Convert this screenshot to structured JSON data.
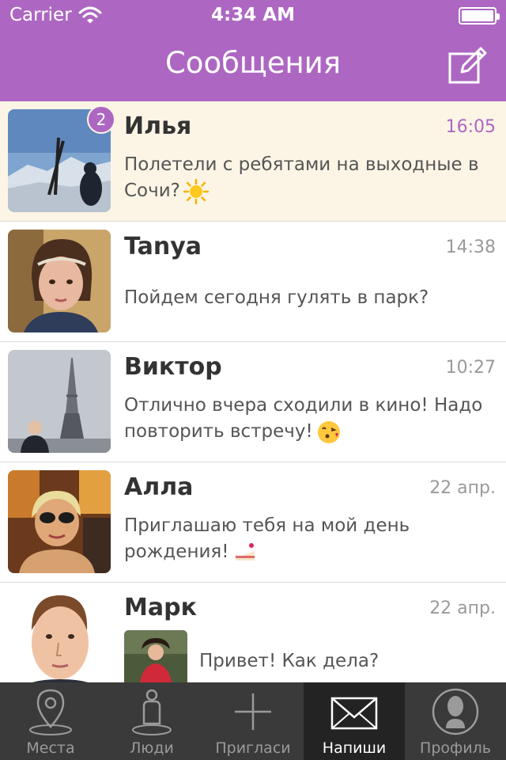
{
  "status_bar": {
    "carrier": "Carrier",
    "time": "4:34 AM"
  },
  "header": {
    "title": "Сообщения"
  },
  "conversations": [
    {
      "name": "Илья",
      "time": "16:05",
      "unread_count": "2",
      "message": "Полетели с ребятами на выходные в Сочи?",
      "emoji": "sun-emoji"
    },
    {
      "name": "Tanya",
      "time": "14:38",
      "message": "Пойдем сегодня гулять в парк?"
    },
    {
      "name": "Виктор",
      "time": "10:27",
      "message": "Отлично вчера сходили в кино! Надо повторить встречу!",
      "emoji": "kiss-emoji"
    },
    {
      "name": "Алла",
      "time": "22 апр.",
      "message": "Приглашаю тебя на мой день рождения!",
      "emoji": "cake-emoji"
    },
    {
      "name": "Марк",
      "time": "22 апр.",
      "message": "Привет! Как дела?"
    }
  ],
  "tabs": [
    {
      "label": "Места",
      "icon": "location-pin-icon"
    },
    {
      "label": "Люди",
      "icon": "person-icon"
    },
    {
      "label": "Пригласи",
      "icon": "plus-icon"
    },
    {
      "label": "Напиши",
      "icon": "envelope-icon",
      "active": true
    },
    {
      "label": "Профиль",
      "icon": "profile-icon"
    }
  ],
  "colors": {
    "accent": "#ad67c2",
    "unread_bg": "#fcf5e6",
    "tab_bar": "#3a3a3a",
    "tab_active": "#232323"
  }
}
